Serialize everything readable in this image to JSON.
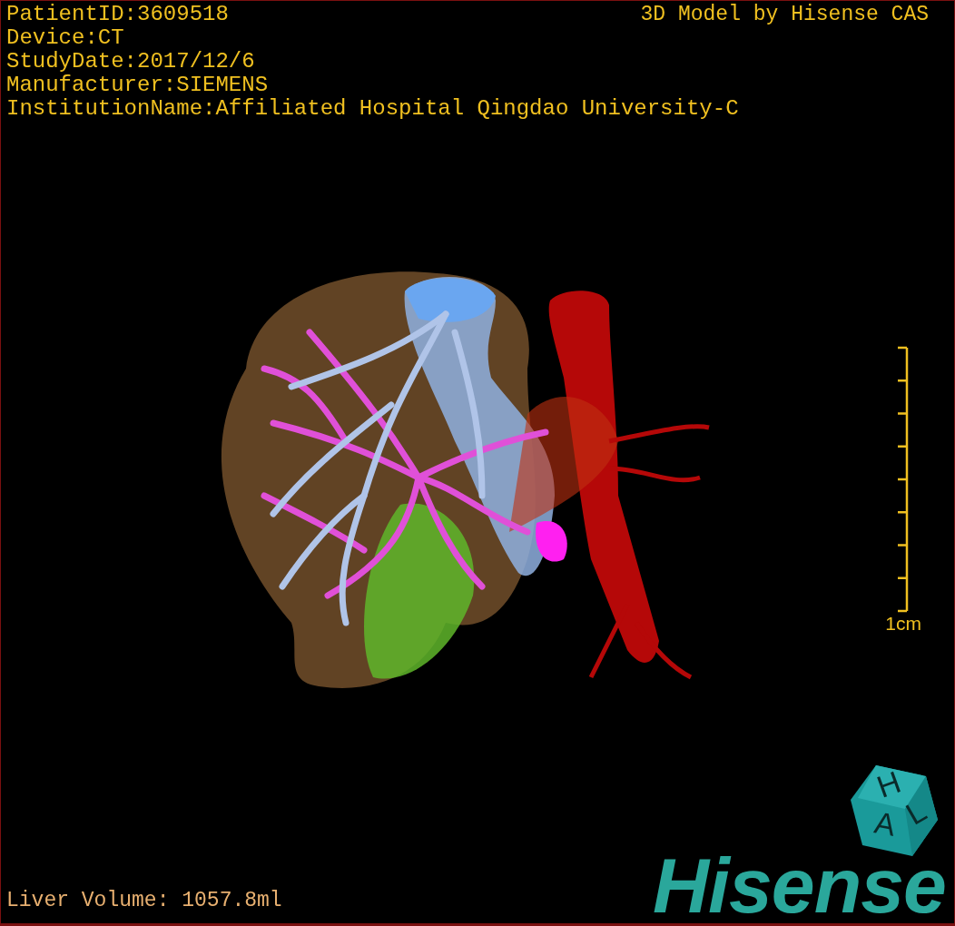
{
  "study_info": {
    "lines": [
      "PatientID:3609518",
      "Device:CT",
      "StudyDate:2017/12/6",
      "Manufacturer:SIEMENS",
      "InstitutionName:Affiliated Hospital Qingdao University-C"
    ]
  },
  "credit": "3D Model by Hisense CAS",
  "scale_bar": {
    "label": "1cm"
  },
  "orientation_cube": {
    "letters": [
      "H",
      "A",
      "L"
    ]
  },
  "logo": "Hisense",
  "footer": {
    "liver_volume": "Liver Volume: 1057.8ml"
  }
}
